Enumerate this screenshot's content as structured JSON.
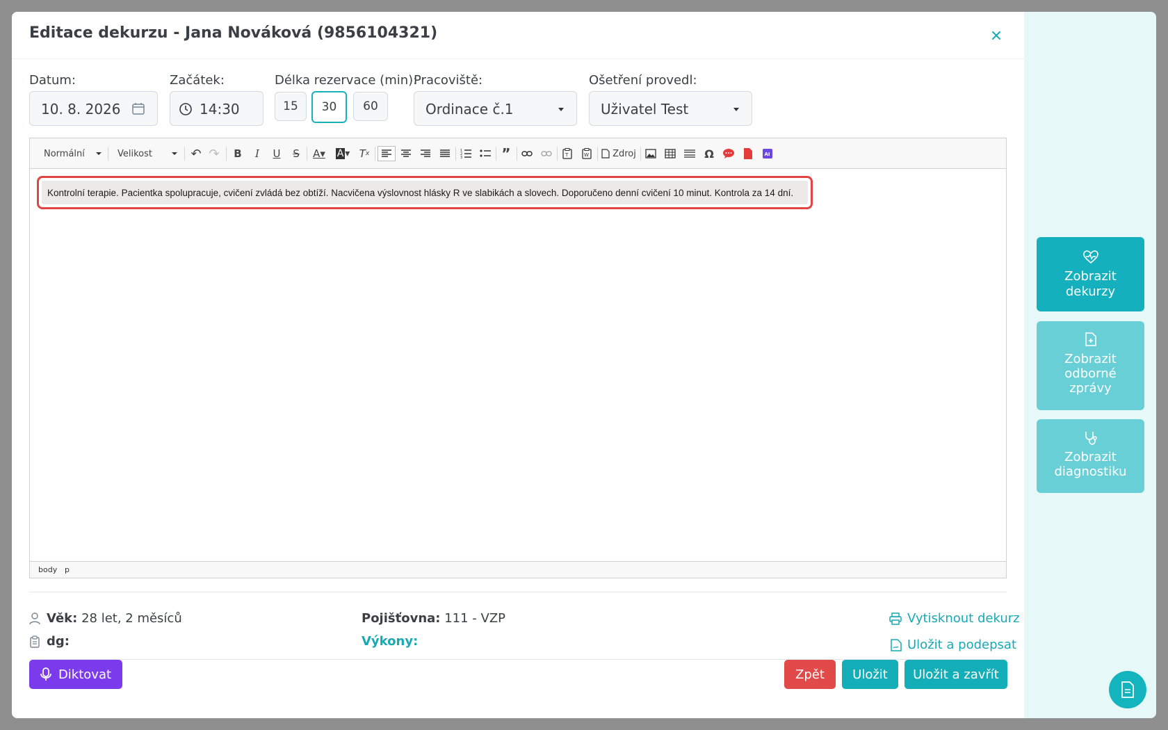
{
  "dialog": {
    "title": "Editace dekurzu - Jana Nováková (9856104321)"
  },
  "form": {
    "date_label": "Datum:",
    "date_value": "10. 8. 2026",
    "start_label": "Začátek:",
    "start_value": "14:30",
    "duration_label": "Délka rezervace (min):",
    "durations": [
      "15",
      "30",
      "60"
    ],
    "duration_selected": "30",
    "workplace_label": "Pracoviště:",
    "workplace_value": "Ordinace č.1",
    "performed_by_label": "Ošetření provedl:",
    "performed_by_value": "Uživatel Test"
  },
  "editor": {
    "format_select": "Normální",
    "size_select": "Velikost",
    "source_label": "Zdroj",
    "content": "Kontrolní terapie. Pacientka spolupracuje, cvičení zvládá bez obtíží. Nacvičena výslovnost hlásky R ve slabikách a slovech. Doporučeno denní cvičení 10 minut. Kontrola za 14 dní.",
    "path": [
      "body",
      "p"
    ]
  },
  "patient_info": {
    "age_label": "Věk:",
    "age_value": "28 let, 2 měsíců",
    "dg_label": "dg:",
    "insurance_label": "Pojišťovna:",
    "insurance_value": "111 - VZP",
    "procedures_label": "Výkony:"
  },
  "links": {
    "print": "Vytisknout dekurz",
    "save_sign": "Uložit a podepsat"
  },
  "buttons": {
    "dictate": "Diktovat",
    "back": "Zpět",
    "save": "Uložit",
    "save_close": "Uložit a zavřít"
  },
  "sidebar": {
    "show_records_1": "Zobrazit",
    "show_records_2": "dekurzy",
    "show_reports_1": "Zobrazit",
    "show_reports_2": "odborné",
    "show_reports_3": "zprávy",
    "show_diag_1": "Zobrazit",
    "show_diag_2": "diagnostiku"
  },
  "colors": {
    "accent": "#17b2be",
    "danger": "#e24a4a",
    "dictate": "#7c3aed"
  }
}
